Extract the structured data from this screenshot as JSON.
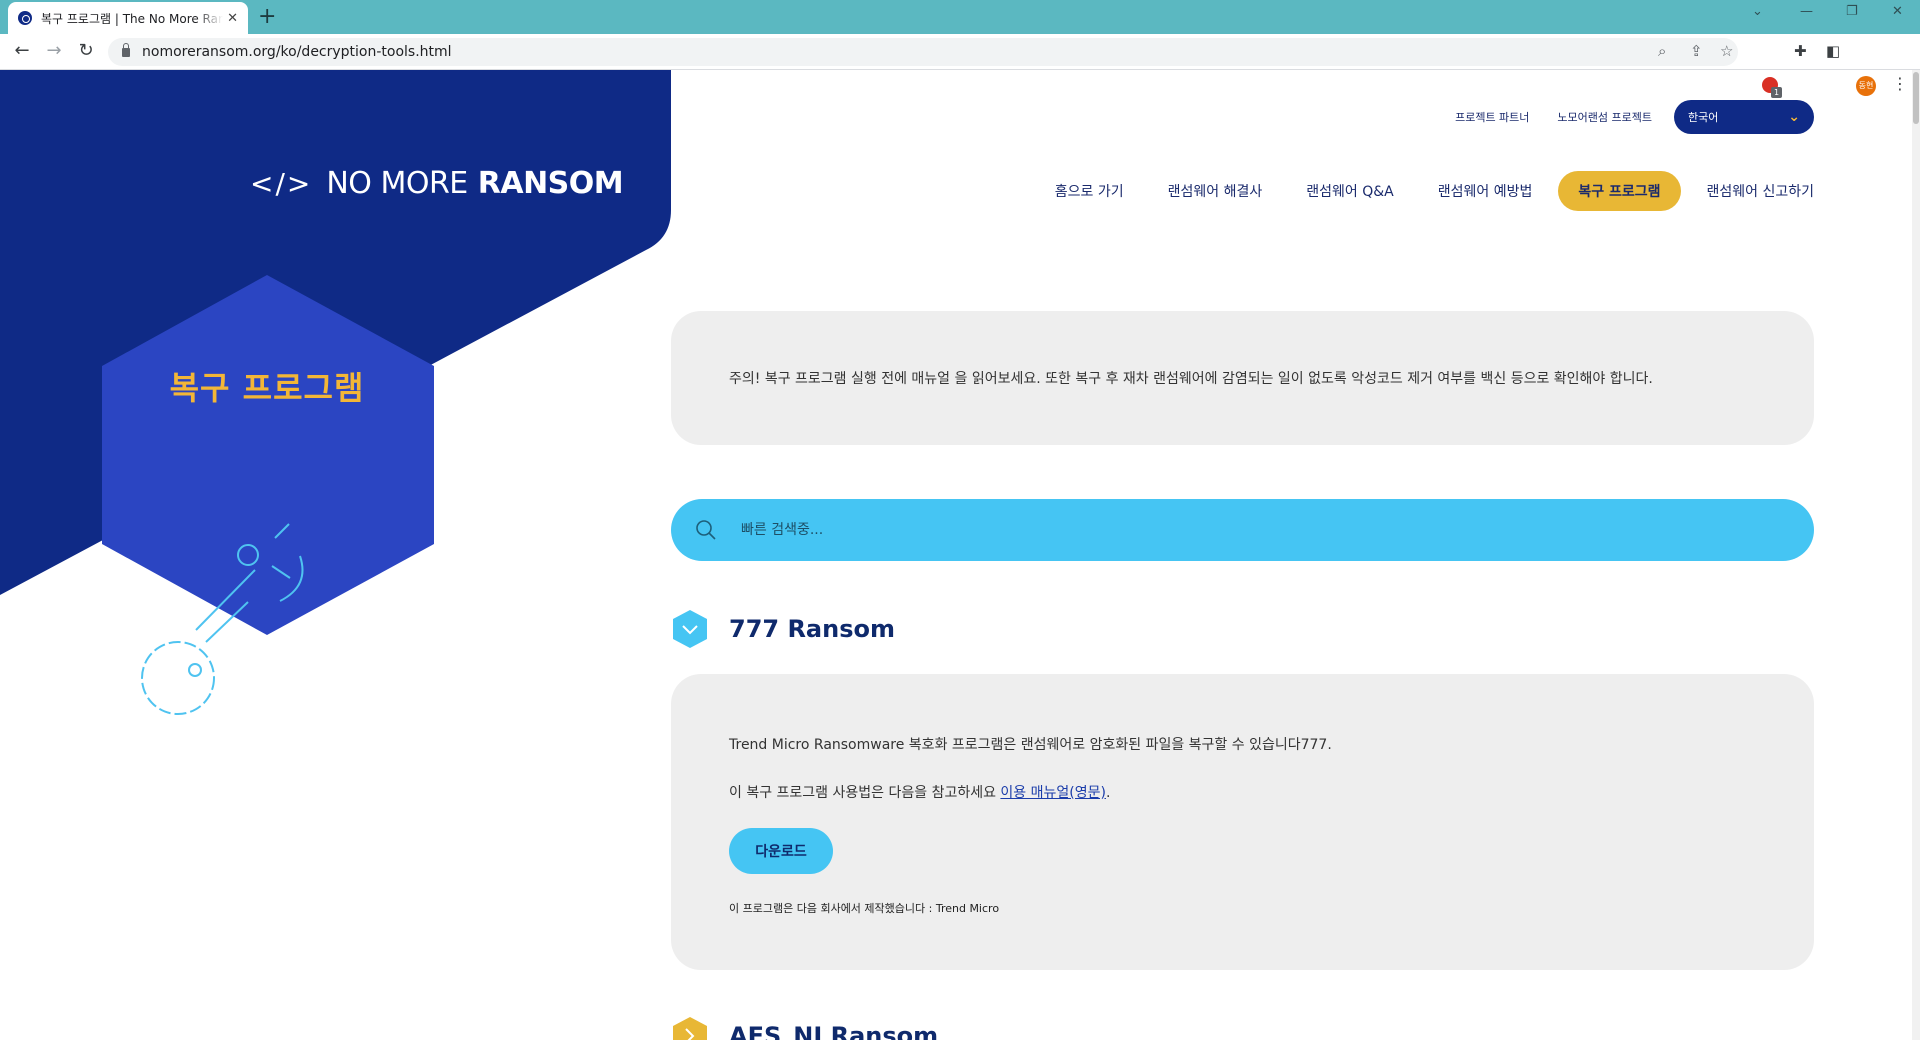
{
  "browser": {
    "tab_title": "복구 프로그램 | The No More Ransom Project",
    "tab_close": "✕",
    "new_tab": "+",
    "url": "nomoreransom.org/ko/decryption-tools.html",
    "extension_badge": "1",
    "profile_initials": "동현"
  },
  "site": {
    "logo_mark": "</>",
    "logo_word1": "NO MORE",
    "logo_word2": "RANSOM",
    "section_title": "복구 프로그램",
    "colors": {
      "navy": "#0f2a86",
      "yellow": "#f3b637",
      "cyan": "#45c5f3",
      "card": "#eeeeee"
    }
  },
  "topnav": {
    "partners": "프로젝트 파트너",
    "project": "노모어랜섬 프로젝트",
    "language": "한국어"
  },
  "mainnav": {
    "items": [
      "홈으로 가기",
      "랜섬웨어 해결사",
      "랜섬웨어 Q&A",
      "랜섬웨어 예방법",
      "복구 프로그램",
      "랜섬웨어 신고하기"
    ],
    "active_index": 4
  },
  "notice": "주의! 복구 프로그램 실행 전에 매뉴얼 을 읽어보세요. 또한 복구 후 재차 랜섬웨어에 감염되는 일이 없도록 악성코드 제거 여부를 백신 등으로 확인해야 합니다.",
  "search": {
    "placeholder": "빠른 검색중..."
  },
  "entries": [
    {
      "name": "777 Ransom",
      "description": "Trend Micro Ransomware 복호화 프로그램은 랜섬웨어로 암호화된 파일을 복구할 수 있습니다777.",
      "usage_prefix": "이 복구 프로그램 사용법은 다음을 참고하세요 ",
      "usage_link": "이용 매뉴얼(영문)",
      "usage_suffix": ".",
      "download_label": "다운로드",
      "maker": "이 프로그램은 다음 회사에서 제작했습니다 : Trend Micro"
    },
    {
      "name": "AES_NI Ransom"
    }
  ]
}
